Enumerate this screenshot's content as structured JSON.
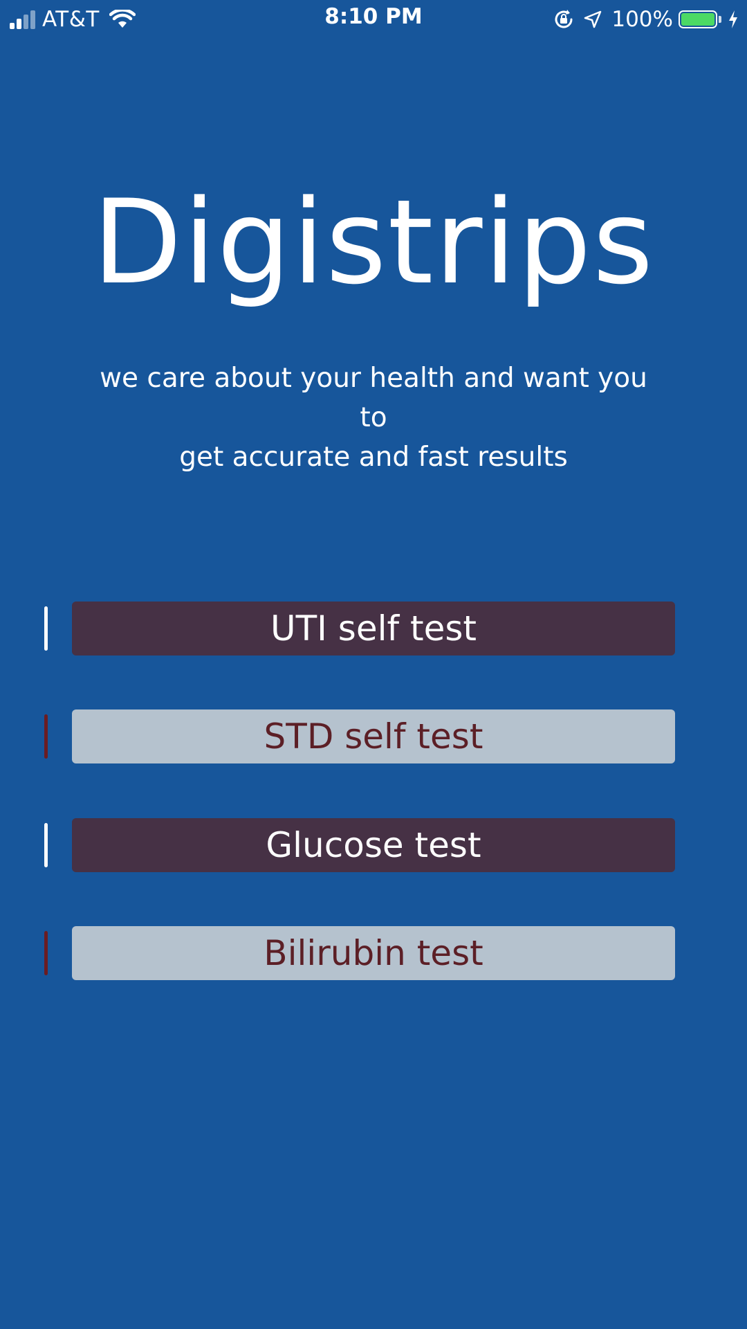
{
  "status_bar": {
    "carrier": "AT&T",
    "time": "8:10 PM",
    "battery_percent": "100%",
    "battery_fill_fraction": 1.0,
    "battery_color": "#4cd964",
    "icons": [
      "cellular-signal-icon",
      "wifi-icon",
      "rotation-lock-icon",
      "location-arrow-icon",
      "battery-icon",
      "charging-bolt-icon"
    ]
  },
  "hero": {
    "title": "Digistrips",
    "tagline_line1": "we care about your health and want you to",
    "tagline_line2": "get accurate and fast results"
  },
  "tests": [
    {
      "label": "UTI self test",
      "style": "dark"
    },
    {
      "label": "STD self test",
      "style": "light"
    },
    {
      "label": "Glucose test",
      "style": "dark"
    },
    {
      "label": "Bilirubin test",
      "style": "light"
    }
  ],
  "colors": {
    "background": "#17569b",
    "button_dark": "#463145",
    "button_light": "#b5c2ce",
    "text_light_button": "#5c1f26",
    "indicator_dark": "#6b1c22"
  }
}
